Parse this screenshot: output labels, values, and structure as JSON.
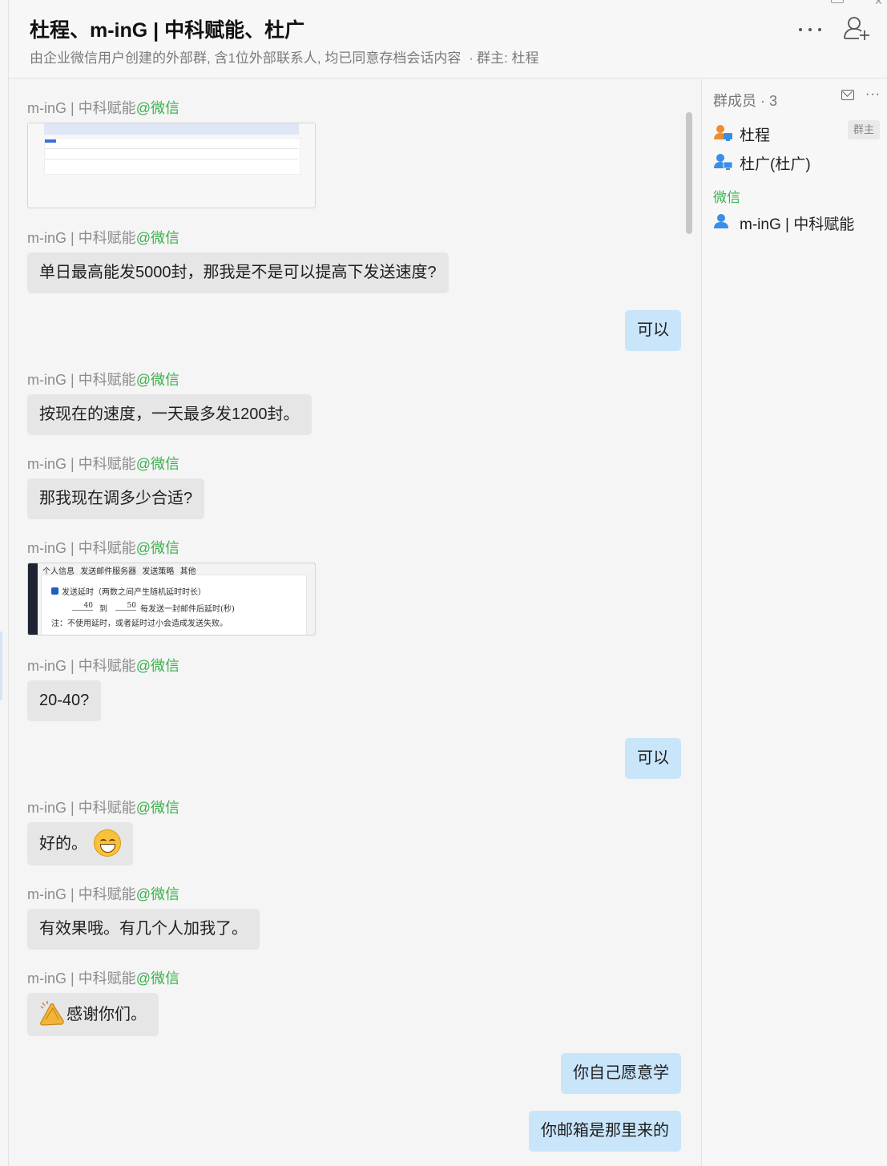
{
  "header": {
    "title": "杜程、m-inG | 中科赋能、杜广",
    "subtitle": "由企业微信用户创建的外部群, 含1位外部联系人, 均已同意存档会话内容",
    "owner_sep": "·",
    "owner_text": "群主: 杜程"
  },
  "icons": {
    "more": "more-horizontal-icon",
    "add_member": "add-user-icon",
    "mail": "mail-icon",
    "emoji_grin": "grinning-face-icon",
    "clap": "clapping-hands-icon"
  },
  "messages": [
    {
      "sender": "m-inG | 中科赋能",
      "sender_suffix": "@微信",
      "type": "image"
    },
    {
      "sender": "m-inG | 中科赋能",
      "sender_suffix": "@微信",
      "type": "text",
      "text": "单日最高能发5000封，那我是不是可以提高下发送速度?"
    },
    {
      "from_me": true,
      "type": "text",
      "text": "可以"
    },
    {
      "sender": "m-inG | 中科赋能",
      "sender_suffix": "@微信",
      "type": "text",
      "text": "按现在的速度，一天最多发1200封。"
    },
    {
      "sender": "m-inG | 中科赋能",
      "sender_suffix": "@微信",
      "type": "text",
      "text": "那我现在调多少合适?"
    },
    {
      "sender": "m-inG | 中科赋能",
      "sender_suffix": "@微信",
      "type": "image",
      "image_text": {
        "tabs": [
          "个人信息",
          "发送邮件服务器",
          "发送策略",
          "其他"
        ],
        "checkbox_label": "发送延时（两数之间产生随机延时时长）",
        "from_value": "40",
        "to_label": "到",
        "to_value": "50",
        "unit_label": "每发送一封邮件后延时(秒)",
        "note": "注：不使用延时，或者延时过小会造成发送失败。"
      }
    },
    {
      "sender": "m-inG | 中科赋能",
      "sender_suffix": "@微信",
      "type": "text",
      "text": "20-40?"
    },
    {
      "from_me": true,
      "type": "text",
      "text": "可以"
    },
    {
      "sender": "m-inG | 中科赋能",
      "sender_suffix": "@微信",
      "type": "text",
      "text": "好的。"
    },
    {
      "sender": "m-inG | 中科赋能",
      "sender_suffix": "@微信",
      "type": "text",
      "text": "有效果哦。有几个人加我了。"
    },
    {
      "sender": "m-inG | 中科赋能",
      "sender_suffix": "@微信",
      "type": "text",
      "text": "感谢你们。"
    },
    {
      "from_me": true,
      "type": "text",
      "text": "你自己愿意学"
    },
    {
      "from_me": true,
      "type": "text",
      "text": "你邮箱是那里来的"
    }
  ],
  "members": {
    "header": "群成员 · 3",
    "internal": [
      {
        "name": "杜程",
        "badge": "群主",
        "icon_color": "#f08c2e"
      },
      {
        "name": "杜广(杜广)",
        "icon_color": "#3a8ee6"
      }
    ],
    "group_label": "微信",
    "external": [
      {
        "name": "m-inG | 中科赋能",
        "icon_color": "#3a8ee6"
      }
    ]
  }
}
